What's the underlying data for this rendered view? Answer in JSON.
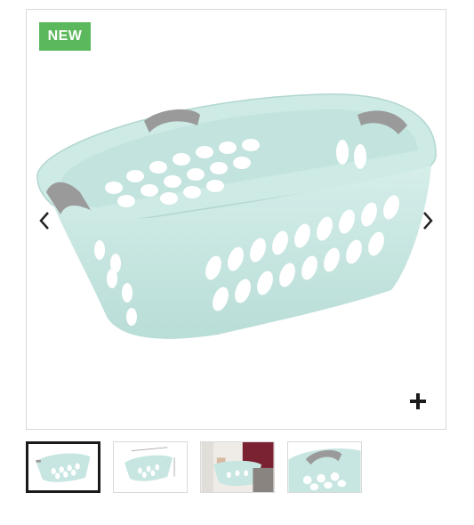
{
  "badge": {
    "label": "NEW",
    "color": "#5cb85c"
  },
  "gallery": {
    "prev_icon": "chevron-left-icon",
    "next_icon": "chevron-right-icon",
    "zoom_icon": "plus-icon",
    "product_color": "#c7e6e1",
    "handle_color": "#9a9a9a",
    "thumbnails": [
      {
        "name": "basket-front",
        "active": true
      },
      {
        "name": "basket-dimensions",
        "active": false
      },
      {
        "name": "basket-in-use",
        "active": false
      },
      {
        "name": "basket-handle-detail",
        "active": false
      }
    ]
  }
}
